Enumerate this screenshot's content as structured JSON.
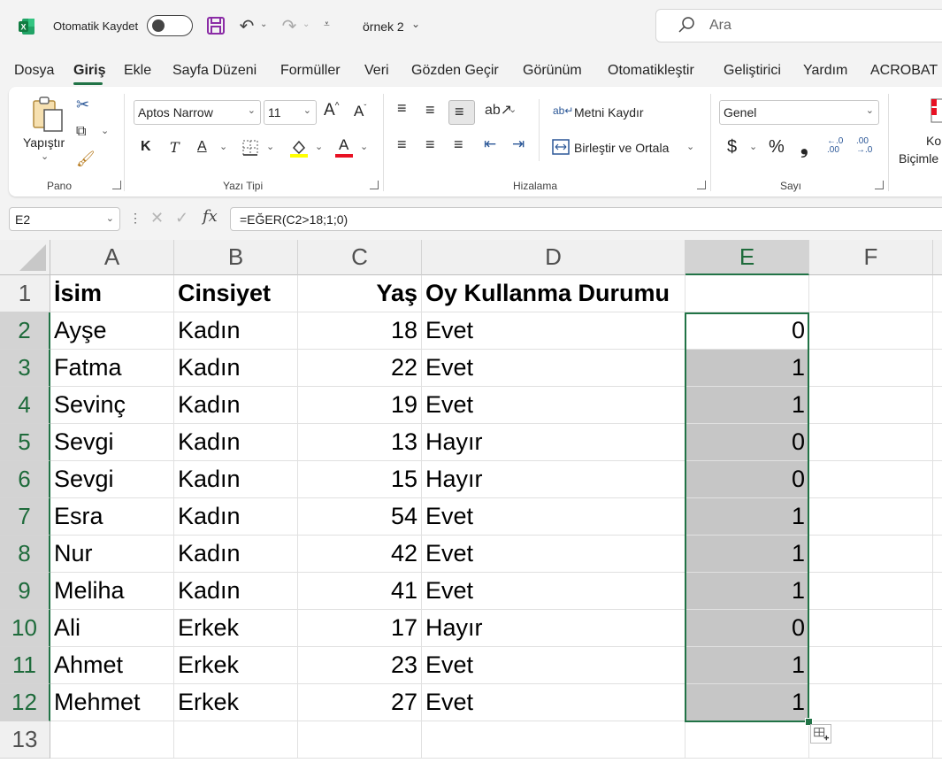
{
  "titlebar": {
    "autosave_label": "Otomatik Kaydet",
    "doc_title": "örnek 2",
    "search_placeholder": "Ara"
  },
  "tabs": [
    "Dosya",
    "Giriş",
    "Ekle",
    "Sayfa Düzeni",
    "Formüller",
    "Veri",
    "Gözden Geçir",
    "Görünüm",
    "Otomatikleştir",
    "Geliştirici",
    "Yardım",
    "ACROBAT"
  ],
  "ribbon": {
    "clipboard": {
      "paste_label": "Yapıştır",
      "group_label": "Pano"
    },
    "font": {
      "font_name": "Aptos Narrow",
      "font_size": "11",
      "bold": "K",
      "italic": "T",
      "underline": "A",
      "group_label": "Yazı Tipi"
    },
    "alignment": {
      "wrap_text": "Metni Kaydır",
      "merge_center": "Birleştir ve Ortala",
      "group_label": "Hizalama"
    },
    "number": {
      "format": "Genel",
      "currency": "$",
      "percent": "%",
      "comma": "❟",
      "group_label": "Sayı"
    },
    "styles": {
      "conditional_line1": "Ko",
      "conditional_line2": "Biçimle"
    }
  },
  "formula_bar": {
    "name_box": "E2",
    "formula": "=EĞER(C2>18;1;0)",
    "fx": "fx"
  },
  "sheet": {
    "columns": [
      "A",
      "B",
      "C",
      "D",
      "E",
      "F"
    ],
    "row_numbers": [
      "1",
      "2",
      "3",
      "4",
      "5",
      "6",
      "7",
      "8",
      "9",
      "10",
      "11",
      "12",
      "13"
    ],
    "header_row": [
      "İsim",
      "Cinsiyet",
      "Yaş",
      "Oy Kullanma Durumu",
      ""
    ],
    "rows": [
      [
        "Ayşe",
        "Kadın",
        "18",
        "Evet",
        "0"
      ],
      [
        "Fatma",
        "Kadın",
        "22",
        "Evet",
        "1"
      ],
      [
        "Sevinç",
        "Kadın",
        "19",
        "Evet",
        "1"
      ],
      [
        "Sevgi",
        "Kadın",
        "13",
        "Hayır",
        "0"
      ],
      [
        "Sevgi",
        "Kadın",
        "15",
        "Hayır",
        "0"
      ],
      [
        "Esra",
        "Kadın",
        "54",
        "Evet",
        "1"
      ],
      [
        "Nur",
        "Kadın",
        "42",
        "Evet",
        "1"
      ],
      [
        "Meliha",
        "Kadın",
        "41",
        "Evet",
        "1"
      ],
      [
        "Ali",
        "Erkek",
        "17",
        "Hayır",
        "0"
      ],
      [
        "Ahmet",
        "Erkek",
        "23",
        "Evet",
        "1"
      ],
      [
        "Mehmet",
        "Erkek",
        "27",
        "Evet",
        "1"
      ]
    ],
    "selected_column": "E",
    "selected_range": "E2:E12"
  },
  "colors": {
    "accent": "#217346",
    "selection_fill": "#c6c6c6",
    "font_color": "#e81123",
    "fill_color": "#ffff00"
  }
}
